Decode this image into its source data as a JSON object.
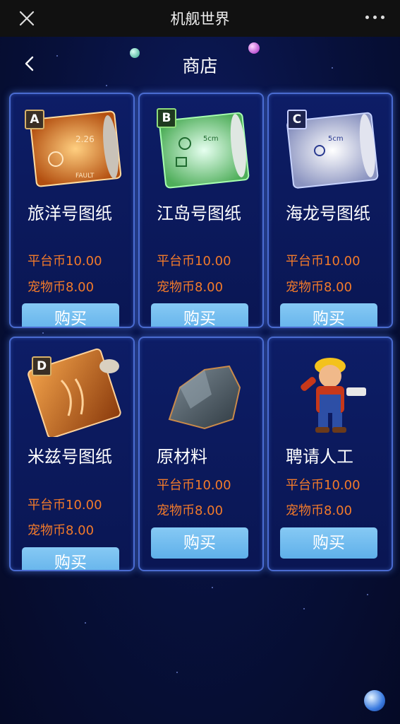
{
  "topbar": {
    "title": "机舰世界"
  },
  "header": {
    "title": "商店"
  },
  "products": [
    {
      "name": "旅洋号图纸",
      "platform_price": "平台币10.00",
      "pet_price": "宠物币8.00",
      "buy_label": "购买",
      "badge": "A",
      "icon": "blueprint-scroll-orange-icon"
    },
    {
      "name": "江岛号图纸",
      "platform_price": "平台币10.00",
      "pet_price": "宠物币8.00",
      "buy_label": "购买",
      "badge": "B",
      "icon": "blueprint-scroll-green-icon"
    },
    {
      "name": "海龙号图纸",
      "platform_price": "平台币10.00",
      "pet_price": "宠物币8.00",
      "buy_label": "购买",
      "badge": "C",
      "icon": "blueprint-scroll-silver-icon"
    },
    {
      "name": "米兹号图纸",
      "platform_price": "平台币10.00",
      "pet_price": "宠物币8.00",
      "buy_label": "购买",
      "badge": "D",
      "icon": "blueprint-scroll-bronze-icon"
    },
    {
      "name": "原材料",
      "platform_price": "平台币10.00",
      "pet_price": "宠物币8.00",
      "buy_label": "购买",
      "icon": "raw-material-rock-icon"
    },
    {
      "name": "聘请人工",
      "platform_price": "平台币10.00",
      "pet_price": "宠物币8.00",
      "buy_label": "购买",
      "icon": "worker-character-icon"
    }
  ],
  "colors": {
    "price": "#f27a2a",
    "buy_button": "#6cb9ee",
    "card_border": "#4a6bd0"
  }
}
